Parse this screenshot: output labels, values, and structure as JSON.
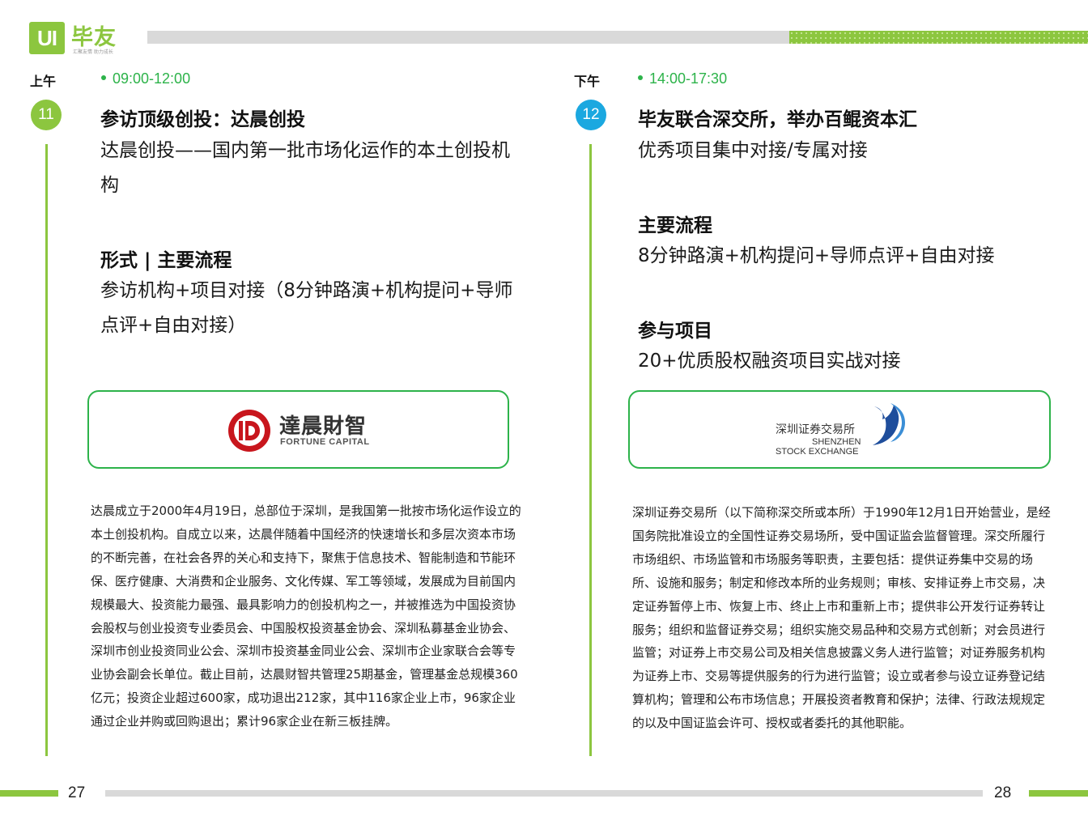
{
  "brand": {
    "logo_mark": "UI",
    "name": "毕友",
    "tagline": "汇聚友情  助力成长",
    "accent_color": "#8cc63f",
    "green_color": "#2db34a",
    "blue_color": "#1ba8e0"
  },
  "left": {
    "period": "上午",
    "time": "09:00-12:00",
    "number": "11",
    "title": "参访顶级创投：达晨创投",
    "subtitle": "达晨创投——国内第一批市场化运作的本土创投机构",
    "section_title": "形式 | 主要流程",
    "section_body": "参访机构+项目对接（8分钟路演+机构提问+导师点评+自由对接）",
    "logo_cn": "達晨財智",
    "logo_en": "FORTUNE CAPITAL",
    "description": "达晨成立于2000年4月19日，总部位于深圳，是我国第一批按市场化运作设立的本土创投机构。自成立以来，达晨伴随着中国经济的快速增长和多层次资本市场的不断完善，在社会各界的关心和支持下，聚焦于信息技术、智能制造和节能环保、医疗健康、大消费和企业服务、文化传媒、军工等领域，发展成为目前国内规模最大、投资能力最强、最具影响力的创投机构之一，并被推选为中国投资协会股权与创业投资专业委员会、中国股权投资基金协会、深圳私募基金业协会、深圳市创业投资同业公会、深圳市投资基金同业公会、深圳市企业家联合会等专业协会副会长单位。截止目前，达晨财智共管理25期基金，管理基金总规模360亿元；投资企业超过600家，成功退出212家，其中116家企业上市，96家企业通过企业并购或回购退出；累计96家企业在新三板挂牌。",
    "page": "27"
  },
  "right": {
    "period": "下午",
    "time": "14:00-17:30",
    "number": "12",
    "title": "毕友联合深交所，举办百鲲资本汇",
    "subtitle": "优秀项目集中对接/专属对接",
    "section1_title": "主要流程",
    "section1_body": "8分钟路演+机构提问+导师点评+自由对接",
    "section2_title": "参与项目",
    "section2_body": "20+优质股权融资项目实战对接",
    "logo_cn": "深圳证券交易所",
    "logo_en1": "SHENZHEN",
    "logo_en2": "STOCK EXCHANGE",
    "description": "深圳证券交易所（以下简称深交所或本所）于1990年12月1日开始营业，是经国务院批准设立的全国性证券交易场所，受中国证监会监督管理。深交所履行市场组织、市场监管和市场服务等职责，主要包括：提供证券集中交易的场所、设施和服务；制定和修改本所的业务规则；审核、安排证券上市交易，决定证券暂停上市、恢复上市、终止上市和重新上市；提供非公开发行证券转让服务；组织和监督证券交易；组织实施交易品种和交易方式创新；对会员进行监管；对证券上市交易公司及相关信息披露义务人进行监管；对证券服务机构为证券上市、交易等提供服务的行为进行监管；设立或者参与设立证券登记结算机构；管理和公布市场信息；开展投资者教育和保护；法律、行政法规规定的以及中国证监会许可、授权或者委托的其他职能。",
    "page": "28"
  }
}
